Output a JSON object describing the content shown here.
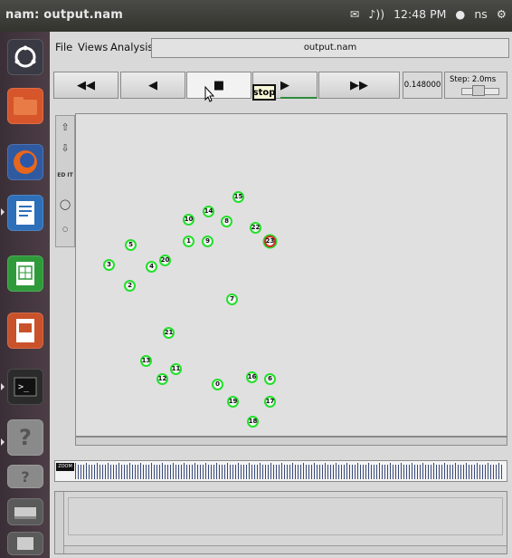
{
  "topbar": {
    "window_title": "nam: output.nam",
    "time": "12:48 PM",
    "user": "ns"
  },
  "menu": {
    "file": "File",
    "views": "Views",
    "analysis": "Analysis",
    "filename": "output.nam"
  },
  "controls": {
    "rewind": "◀◀",
    "back": "◀",
    "stop": "■",
    "play": "▶",
    "fastforward": "▶▶",
    "time_value": "0.148000",
    "step_label": "Step: 2.0ms",
    "tooltip": "stop"
  },
  "tools": {
    "edit": "ED IT"
  },
  "timeline": {
    "zoom_label": "ZOOM"
  },
  "nodes": [
    {
      "id": "0"
    },
    {
      "id": "1"
    },
    {
      "id": "2"
    },
    {
      "id": "3"
    },
    {
      "id": "4"
    },
    {
      "id": "5"
    },
    {
      "id": "6"
    },
    {
      "id": "7"
    },
    {
      "id": "8"
    },
    {
      "id": "9"
    },
    {
      "id": "10"
    },
    {
      "id": "11"
    },
    {
      "id": "12"
    },
    {
      "id": "13"
    },
    {
      "id": "14"
    },
    {
      "id": "15"
    },
    {
      "id": "16"
    },
    {
      "id": "17"
    },
    {
      "id": "18"
    },
    {
      "id": "19"
    },
    {
      "id": "20"
    },
    {
      "id": "21"
    },
    {
      "id": "22"
    },
    {
      "id": "23"
    },
    {
      "id": "1"
    },
    {
      "id": "5"
    }
  ],
  "colors": {
    "node_ring": "#22e02b",
    "highlight_ring": "#d42a2a",
    "launcher": "#4d3e46"
  }
}
